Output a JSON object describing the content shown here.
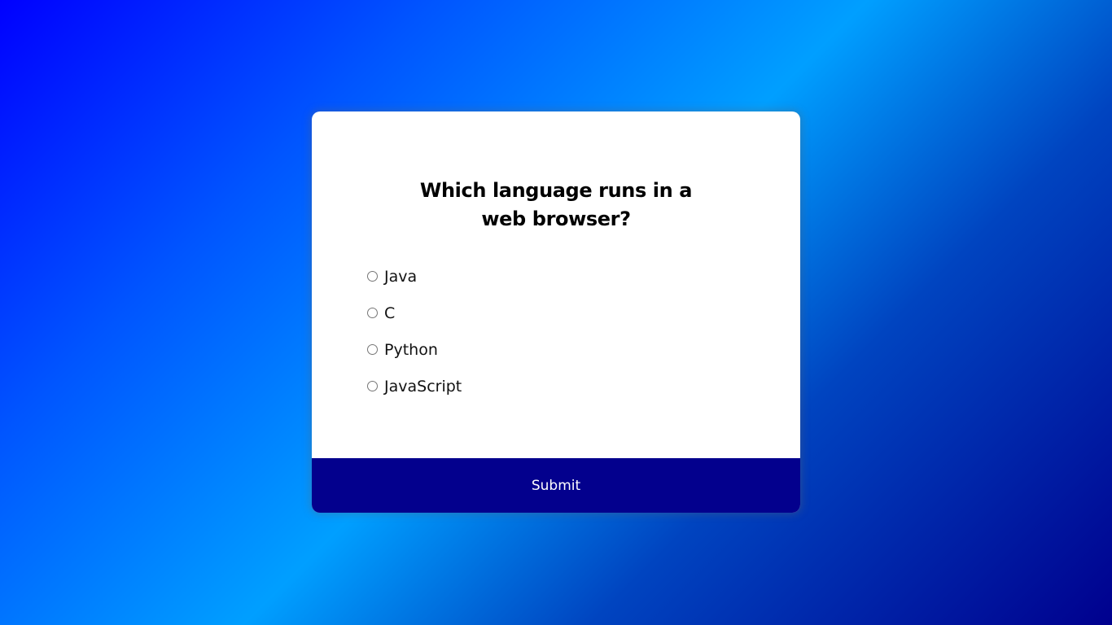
{
  "quiz": {
    "question": "Which language runs in a web browser?",
    "answers": [
      {
        "label": "Java"
      },
      {
        "label": "C"
      },
      {
        "label": "Python"
      },
      {
        "label": "JavaScript"
      }
    ],
    "submit_label": "Submit"
  },
  "colors": {
    "submit_background": "#03008d",
    "background_gradient": [
      "#0000ff",
      "#0055ff",
      "#009fff",
      "#0044c0",
      "#00008e"
    ]
  }
}
